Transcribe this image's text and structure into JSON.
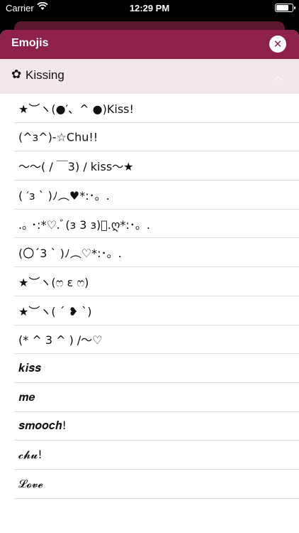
{
  "status_bar": {
    "carrier": "Carrier",
    "time": "12:29 PM",
    "battery_level": 0.85
  },
  "sheet": {
    "title": "Emojis",
    "close_icon": "close-icon"
  },
  "section": {
    "icon": "✿",
    "label": "Kissing",
    "chevron_icon": "chevron-up-icon"
  },
  "items": [
    "★︶ヽ(●′、^ ●)Kiss!",
    "(^ɜ^)-☆Chu!!",
    "～～( / ￣3) /  kiss～★",
    "( ′ɜ ` )ﾉ︵♥*:･。.",
    ".｡ ･:*♡.ﾞ(ɜ 3 ɜ)ﾞ.ღ*:･。.",
    "(〇´3 ` )ﾉ︵♡*:･。.",
    "★︶ヽ(ෆ ε ෆ)",
    "★︶ヽ( ´ ❥ `)",
    " (* ^ 3 ^ )  /～♡",
    "𝒌𝒊𝒔𝒔",
    "𝒎𝒆",
    "𝒔𝒎𝒐𝒐𝒄𝒉!",
    "𝓬𝓱𝓾!",
    "𝓛𝓸𝓿𝓮"
  ],
  "colors": {
    "header": "#8d2149",
    "section_bg": "#f2e7ea",
    "back_card": "#5c1831"
  }
}
